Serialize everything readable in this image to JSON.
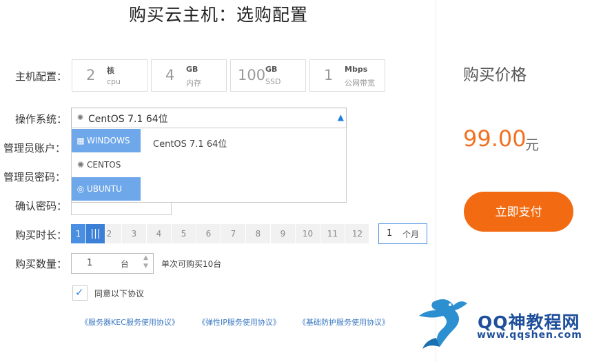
{
  "title": "购买云主机：选购配置",
  "labels": {
    "config": "主机配置：",
    "os": "操作系统：",
    "admin_account": "管理员账户：",
    "admin_password": "管理员密码：",
    "confirm_password": "确认密码：",
    "duration": "购买时长：",
    "quantity": "购买数量："
  },
  "specs": [
    {
      "value": "2",
      "unit": "核",
      "sub": "cpu"
    },
    {
      "value": "4",
      "unit": "GB",
      "sub": "内存"
    },
    {
      "value": "100",
      "unit": "GB",
      "sub": "SSD"
    },
    {
      "value": "1",
      "unit": "Mbps",
      "sub": "公网带宽"
    }
  ],
  "os_select": {
    "value": "CentOS 7.1 64位",
    "options": [
      "WINDOWS",
      "CENTOS",
      "UBUNTU"
    ],
    "version": "CentOS 7.1 64位"
  },
  "duration": {
    "cells": [
      "1",
      "|||",
      "2",
      "3",
      "4",
      "5",
      "6",
      "7",
      "8",
      "9",
      "10",
      "11",
      "12"
    ],
    "value": "1",
    "unit": "个月"
  },
  "quantity": {
    "value": "1",
    "unit": "台",
    "hint": "单次可购买10台"
  },
  "agreement": {
    "label": "同意以下协议",
    "links": [
      "《服务器KEC服务使用协议》",
      "《弹性IP服务使用协议》",
      "《基础防护服务使用协议》"
    ]
  },
  "price": {
    "title": "购买价格",
    "amount": "99.00",
    "unit": "元"
  },
  "pay_button": "立即支付",
  "watermark": {
    "text": "QQ神教程网",
    "url": "www.qqshen.com"
  },
  "colors": {
    "accent": "#f26b12",
    "blue": "#4a8fe2",
    "price": "#f27121"
  }
}
